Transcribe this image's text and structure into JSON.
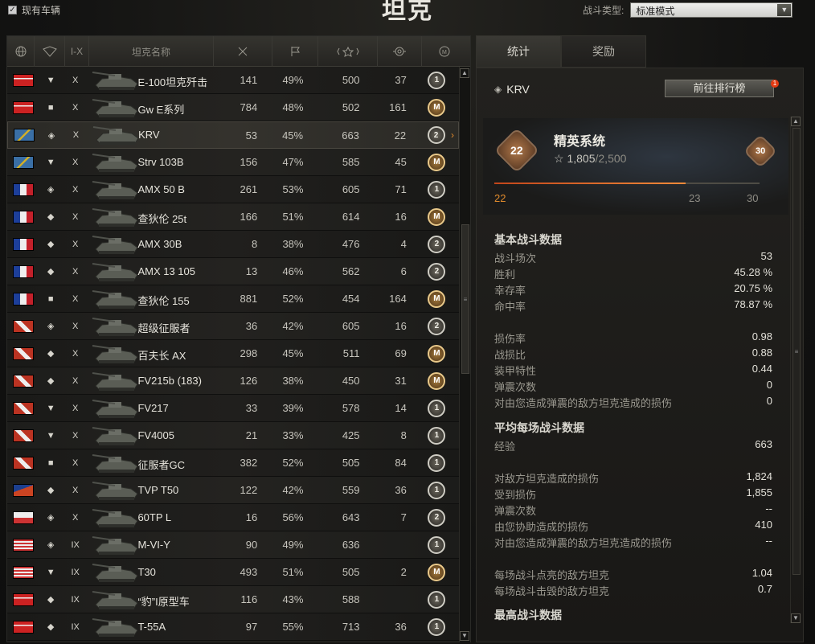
{
  "header": {
    "checkbox_label": "现有车辆",
    "title": "坦克",
    "battle_type_label": "战斗类型:",
    "battle_type_value": "标准模式"
  },
  "table": {
    "col_headers": {
      "tier": "I-X",
      "name": "坦克名称"
    },
    "rows": [
      {
        "flag": "germany",
        "type": "▼",
        "tier": "X",
        "name": "E-100坦克歼击",
        "battles": "141",
        "win": "49%",
        "xp": "500",
        "marks": "37",
        "mastery": "1"
      },
      {
        "flag": "germany",
        "type": "■",
        "tier": "X",
        "name": "Gw E系列",
        "battles": "784",
        "win": "48%",
        "xp": "502",
        "marks": "161",
        "mastery": "M"
      },
      {
        "flag": "sweden",
        "type": "◈",
        "tier": "X",
        "name": "KRV",
        "battles": "53",
        "win": "45%",
        "xp": "663",
        "marks": "22",
        "mastery": "2"
      },
      {
        "flag": "sweden",
        "type": "▼",
        "tier": "X",
        "name": "Strv 103B",
        "battles": "156",
        "win": "47%",
        "xp": "585",
        "marks": "45",
        "mastery": "M"
      },
      {
        "flag": "france",
        "type": "◈",
        "tier": "X",
        "name": "AMX 50 B",
        "battles": "261",
        "win": "53%",
        "xp": "605",
        "marks": "71",
        "mastery": "1"
      },
      {
        "flag": "france",
        "type": "◆",
        "tier": "X",
        "name": "查狄伦 25t",
        "battles": "166",
        "win": "51%",
        "xp": "614",
        "marks": "16",
        "mastery": "M"
      },
      {
        "flag": "france",
        "type": "◆",
        "tier": "X",
        "name": "AMX 30B",
        "battles": "8",
        "win": "38%",
        "xp": "476",
        "marks": "4",
        "mastery": "2"
      },
      {
        "flag": "france",
        "type": "◆",
        "tier": "X",
        "name": "AMX 13 105",
        "battles": "13",
        "win": "46%",
        "xp": "562",
        "marks": "6",
        "mastery": "2"
      },
      {
        "flag": "france",
        "type": "■",
        "tier": "X",
        "name": "查狄伦 155",
        "battles": "881",
        "win": "52%",
        "xp": "454",
        "marks": "164",
        "mastery": "M"
      },
      {
        "flag": "uk",
        "type": "◈",
        "tier": "X",
        "name": "超级征服者",
        "battles": "36",
        "win": "42%",
        "xp": "605",
        "marks": "16",
        "mastery": "2"
      },
      {
        "flag": "uk",
        "type": "◆",
        "tier": "X",
        "name": "百夫长 AX",
        "battles": "298",
        "win": "45%",
        "xp": "511",
        "marks": "69",
        "mastery": "M"
      },
      {
        "flag": "uk",
        "type": "◆",
        "tier": "X",
        "name": "FV215b (183)",
        "battles": "126",
        "win": "38%",
        "xp": "450",
        "marks": "31",
        "mastery": "M"
      },
      {
        "flag": "uk",
        "type": "▼",
        "tier": "X",
        "name": "FV217",
        "battles": "33",
        "win": "39%",
        "xp": "578",
        "marks": "14",
        "mastery": "1"
      },
      {
        "flag": "uk",
        "type": "▼",
        "tier": "X",
        "name": "FV4005",
        "battles": "21",
        "win": "33%",
        "xp": "425",
        "marks": "8",
        "mastery": "1"
      },
      {
        "flag": "uk",
        "type": "■",
        "tier": "X",
        "name": "征服者GC",
        "battles": "382",
        "win": "52%",
        "xp": "505",
        "marks": "84",
        "mastery": "1"
      },
      {
        "flag": "czech",
        "type": "◆",
        "tier": "X",
        "name": "TVP T50",
        "battles": "122",
        "win": "42%",
        "xp": "559",
        "marks": "36",
        "mastery": "1"
      },
      {
        "flag": "poland",
        "type": "◈",
        "tier": "X",
        "name": "60TP L",
        "battles": "16",
        "win": "56%",
        "xp": "643",
        "marks": "7",
        "mastery": "2"
      },
      {
        "flag": "usa",
        "type": "◈",
        "tier": "IX",
        "name": "M-VI-Y",
        "battles": "90",
        "win": "49%",
        "xp": "636",
        "marks": "",
        "mastery": "1"
      },
      {
        "flag": "usa",
        "type": "▼",
        "tier": "IX",
        "name": "T30",
        "battles": "493",
        "win": "51%",
        "xp": "505",
        "marks": "2",
        "mastery": "M"
      },
      {
        "flag": "germany",
        "type": "◆",
        "tier": "IX",
        "name": "“豹”I原型车",
        "battles": "116",
        "win": "43%",
        "xp": "588",
        "marks": "",
        "mastery": "1"
      },
      {
        "flag": "germany",
        "type": "◆",
        "tier": "IX",
        "name": "T-55A",
        "battles": "97",
        "win": "55%",
        "xp": "713",
        "marks": "36",
        "mastery": "1"
      }
    ]
  },
  "tabs": [
    "统计",
    "奖励"
  ],
  "panel": {
    "tank_name": "KRV",
    "rank_button": "前往排行榜",
    "notif": "1",
    "elite": {
      "title": "精英系统",
      "level": "22",
      "next_badge": "30",
      "xp_current": "1,805",
      "xp_total": "/2,500",
      "progress": 0.72,
      "mark_left": "22",
      "mark_mid": "23",
      "mark_right": "30"
    },
    "basic": {
      "title": "基本战斗数据",
      "items": [
        [
          "战斗场次",
          "53"
        ],
        [
          "胜利",
          "45.28 %"
        ],
        [
          "幸存率",
          "20.75 %"
        ],
        [
          "命中率",
          "78.87 %"
        ]
      ]
    },
    "basic2": {
      "items": [
        [
          "损伤率",
          "0.98"
        ],
        [
          "战损比",
          "0.88"
        ],
        [
          "装甲特性",
          "0.44"
        ],
        [
          "弹震次数",
          "0"
        ],
        [
          "对由您造成弹震的敌方坦克造成的损伤",
          "0"
        ]
      ]
    },
    "avg": {
      "title": "平均每场战斗数据",
      "items": [
        [
          "经验",
          "663"
        ]
      ]
    },
    "avg2": {
      "items": [
        [
          "对敌方坦克造成的损伤",
          "1,824"
        ],
        [
          "受到损伤",
          "1,855"
        ],
        [
          "弹震次数",
          "--"
        ],
        [
          "由您协助造成的损伤",
          "410"
        ],
        [
          "对由您造成弹震的敌方坦克造成的损伤",
          "--"
        ]
      ]
    },
    "avg3": {
      "items": [
        [
          "每场战斗点亮的敌方坦克",
          "1.04"
        ],
        [
          "每场战斗击毁的敌方坦克",
          "0.7"
        ]
      ]
    },
    "best": {
      "title": "最高战斗数据"
    }
  },
  "colors": {
    "accent": "#e08a2c",
    "progress": "#f08a3a"
  }
}
